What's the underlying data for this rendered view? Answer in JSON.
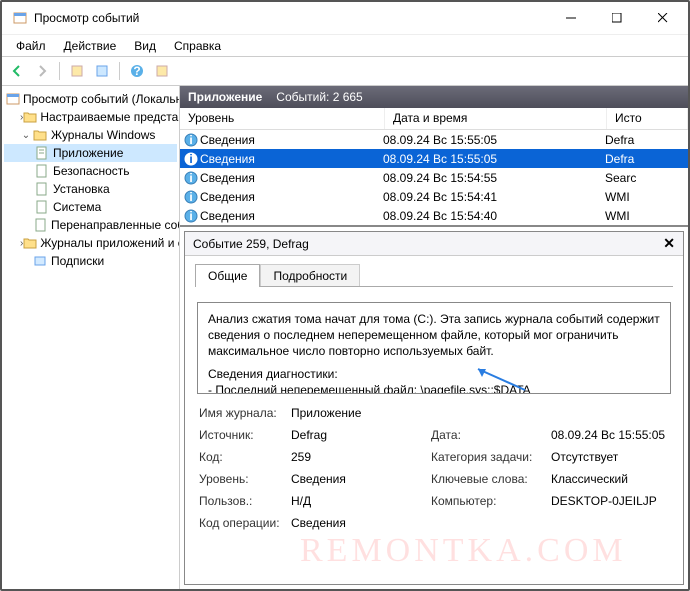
{
  "window": {
    "title": "Просмотр событий"
  },
  "menu": {
    "file": "Файл",
    "action": "Действие",
    "view": "Вид",
    "help": "Справка"
  },
  "tree": {
    "root": "Просмотр событий (Локальн",
    "custom_views": "Настраиваемые представле",
    "win_logs": "Журналы Windows",
    "app": "Приложение",
    "security": "Безопасность",
    "setup": "Установка",
    "system": "Система",
    "forwarded": "Перенаправленные соб",
    "app_services": "Журналы приложений и сл",
    "subscriptions": "Подписки"
  },
  "panel": {
    "title": "Приложение",
    "count_label": "Событий: 2 665"
  },
  "columns": {
    "level": "Уровень",
    "date": "Дата и время",
    "source": "Исто"
  },
  "rows": [
    {
      "level": "Сведения",
      "date": "08.09.24 Bc 15:55:05",
      "source": "Defra"
    },
    {
      "level": "Сведения",
      "date": "08.09.24 Bc 15:55:05",
      "source": "Defra"
    },
    {
      "level": "Сведения",
      "date": "08.09.24 Bc 15:54:55",
      "source": "Searc"
    },
    {
      "level": "Сведения",
      "date": "08.09.24 Bc 15:54:41",
      "source": "WMI"
    },
    {
      "level": "Сведения",
      "date": "08.09.24 Bc 15:54:40",
      "source": "WMI"
    }
  ],
  "detail": {
    "header": "Событие 259, Defrag",
    "tab_general": "Общие",
    "tab_details": "Подробности",
    "message_l1": "Анализ сжатия тома начат для тома (C:). Эта запись журнала событий содержит сведения о последнем неперемещенном файле, который мог ограничить максимальное число повторно используемых байт.",
    "message_l2": "Сведения диагностики:",
    "message_l3": "- Последний неперемещенный файл: \\pagefile.sys::$DATA",
    "fields": {
      "log_lbl": "Имя журнала:",
      "log_val": "Приложение",
      "src_lbl": "Источник:",
      "src_val": "Defrag",
      "date_lbl": "Дата:",
      "date_val": "08.09.24 Bc 15:55:05",
      "id_lbl": "Код:",
      "id_val": "259",
      "cat_lbl": "Категория задачи:",
      "cat_val": "Отсутствует",
      "lvl_lbl": "Уровень:",
      "lvl_val": "Сведения",
      "kw_lbl": "Ключевые слова:",
      "kw_val": "Классический",
      "user_lbl": "Пользов.:",
      "user_val": "Н/Д",
      "comp_lbl": "Компьютер:",
      "comp_val": "DESKTOP-0JEILJP",
      "op_lbl": "Код операции:",
      "op_val": "Сведения"
    }
  },
  "watermark": "REMONTKA.COM"
}
